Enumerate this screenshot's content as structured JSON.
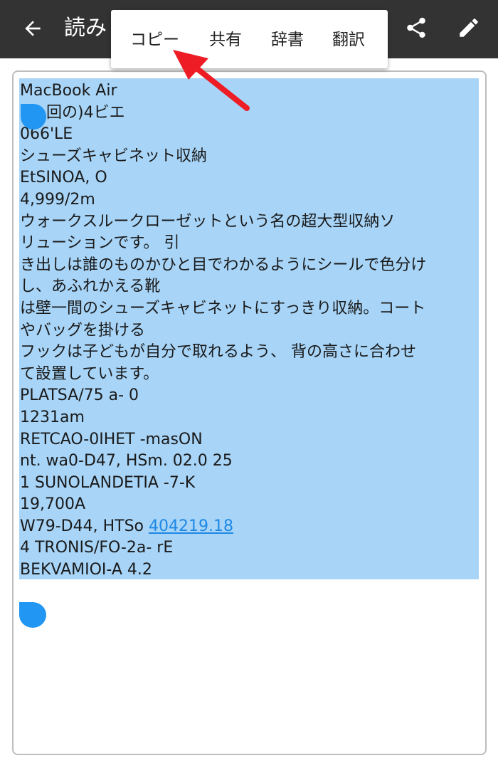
{
  "appbar": {
    "title": "読み",
    "icons": {
      "back": "arrow-left-icon",
      "share": "share-icon",
      "edit": "pencil-icon"
    },
    "background": "#333333"
  },
  "selection_menu": {
    "items": [
      "コピー",
      "共有",
      "辞書",
      "翻訳"
    ]
  },
  "document": {
    "lines": [
      "MacBook Air",
      "回の)4ビエ",
      "066'LE",
      "シューズキャビネット収納",
      "EtSINOA, O",
      "4,999/2m",
      "ウォークスルークローゼットという名の超大型収納ソ",
      "リューションです。 引",
      "き出しは誰のものかひと目でわかるようにシールで色分け",
      "し、あふれかえる靴",
      "は壁一間のシューズキャビネットにすっきり収納。コート",
      "やバッグを掛ける",
      "フックは子どもが自分で取れるよう、 背の高さに合わせ",
      "て設置しています。",
      "PLATSA/75 a- 0",
      "1231am",
      "RETCAO-0IHET -masON",
      "nt. wa0-D47, HSm. 02.0 25",
      "1 SUNOLANDETIA -7-K",
      "19,700A",
      "W79-D44, HTSo",
      "4 TRONIS/FO-2a- rE",
      "BEKVAMIOI-A 4.2"
    ],
    "link_text": "404219.18",
    "selection_color": "#a7d4f7",
    "handle_color": "#2196f3"
  },
  "annotation": {
    "arrow_color": "#ee1c24"
  }
}
